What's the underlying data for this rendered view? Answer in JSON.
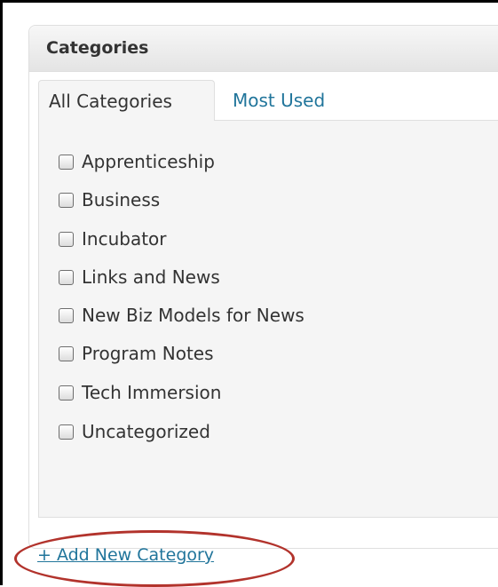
{
  "box": {
    "title": "Categories"
  },
  "tabs": [
    {
      "label": "All Categories",
      "active": true
    },
    {
      "label": "Most Used",
      "active": false
    }
  ],
  "categories": [
    {
      "label": "Apprenticeship",
      "checked": false
    },
    {
      "label": "Business",
      "checked": false
    },
    {
      "label": "Incubator",
      "checked": false
    },
    {
      "label": "Links and News",
      "checked": false
    },
    {
      "label": "New Biz Models for News",
      "checked": false
    },
    {
      "label": "Program Notes",
      "checked": false
    },
    {
      "label": "Tech Immersion",
      "checked": false
    },
    {
      "label": "Uncategorized",
      "checked": false
    }
  ],
  "add_new": {
    "label": "+ Add New Category"
  },
  "colors": {
    "link": "#21759b",
    "highlight": "#b2332c"
  }
}
